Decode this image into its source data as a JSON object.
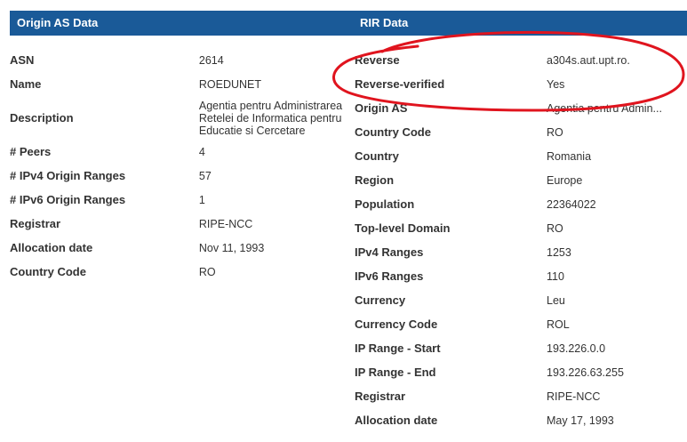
{
  "left": {
    "header": "Origin AS Data",
    "rows": [
      {
        "key": "ASN",
        "value": "2614"
      },
      {
        "key": "Name",
        "value": "ROEDUNET"
      },
      {
        "key": "Description",
        "value_lines": [
          "Agentia pentru Administrarea",
          "Retelei de Informatica pentru",
          "Educatie si Cercetare"
        ]
      },
      {
        "key": "# Peers",
        "value": "4"
      },
      {
        "key": "# IPv4 Origin Ranges",
        "value": "57"
      },
      {
        "key": "# IPv6 Origin Ranges",
        "value": "1"
      },
      {
        "key": "Registrar",
        "value": "RIPE-NCC"
      },
      {
        "key": "Allocation date",
        "value": "Nov 11, 1993"
      },
      {
        "key": "Country Code",
        "value": "RO"
      }
    ]
  },
  "right": {
    "header": "RIR Data",
    "rows": [
      {
        "key": "Reverse",
        "value": "a304s.aut.upt.ro."
      },
      {
        "key": "Reverse-verified",
        "value": "Yes"
      },
      {
        "key": "Origin AS",
        "value": "Agentia pentru Admin..."
      },
      {
        "key": "Country Code",
        "value": "RO"
      },
      {
        "key": "Country",
        "value": "Romania"
      },
      {
        "key": "Region",
        "value": "Europe"
      },
      {
        "key": "Population",
        "value": "22364022"
      },
      {
        "key": "Top-level Domain",
        "value": "RO"
      },
      {
        "key": "IPv4 Ranges",
        "value": "1253"
      },
      {
        "key": "IPv6 Ranges",
        "value": "110"
      },
      {
        "key": "Currency",
        "value": "Leu"
      },
      {
        "key": "Currency Code",
        "value": "ROL"
      },
      {
        "key": "IP Range - Start",
        "value": "193.226.0.0"
      },
      {
        "key": "IP Range - End",
        "value": "193.226.63.255"
      },
      {
        "key": "Registrar",
        "value": "RIPE-NCC"
      },
      {
        "key": "Allocation date",
        "value": "May 17, 1993"
      }
    ]
  },
  "colors": {
    "header_bg": "#1a5a98",
    "annotation": "#e0141e"
  }
}
